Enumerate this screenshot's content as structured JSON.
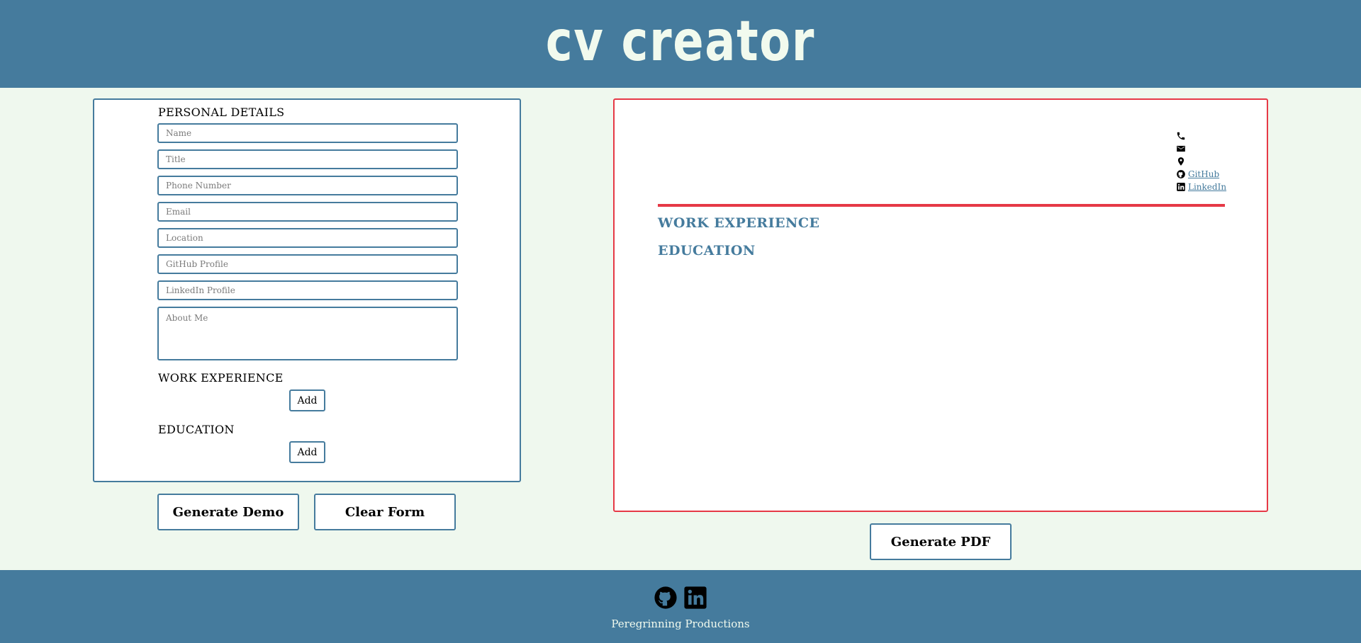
{
  "header": {
    "title": "cv creator"
  },
  "form": {
    "personal_title": "PERSONAL DETAILS",
    "fields": {
      "name": "Name",
      "title": "Title",
      "phone": "Phone Number",
      "email": "Email",
      "location": "Location",
      "github": "GitHub Profile",
      "linkedin": "LinkedIn Profile",
      "about": "About Me"
    },
    "work_title": "WORK EXPERIENCE",
    "work_add": "Add",
    "education_title": "EDUCATION",
    "education_add": "Add"
  },
  "actions": {
    "demo": "Generate Demo",
    "clear": "Clear Form",
    "pdf": "Generate PDF"
  },
  "preview": {
    "contacts": {
      "github": "GitHub",
      "linkedin": "LinkedIn"
    },
    "work_heading": "WORK EXPERIENCE",
    "education_heading": "EDUCATION"
  },
  "footer": {
    "text": "Peregrinning Productions"
  },
  "colors": {
    "primary": "#457b9d",
    "accent": "#e63946",
    "background": "#eff8ee",
    "light": "#f1faee"
  },
  "icons": [
    "phone-icon",
    "envelope-icon",
    "location-pin-icon",
    "github-icon",
    "linkedin-icon"
  ]
}
